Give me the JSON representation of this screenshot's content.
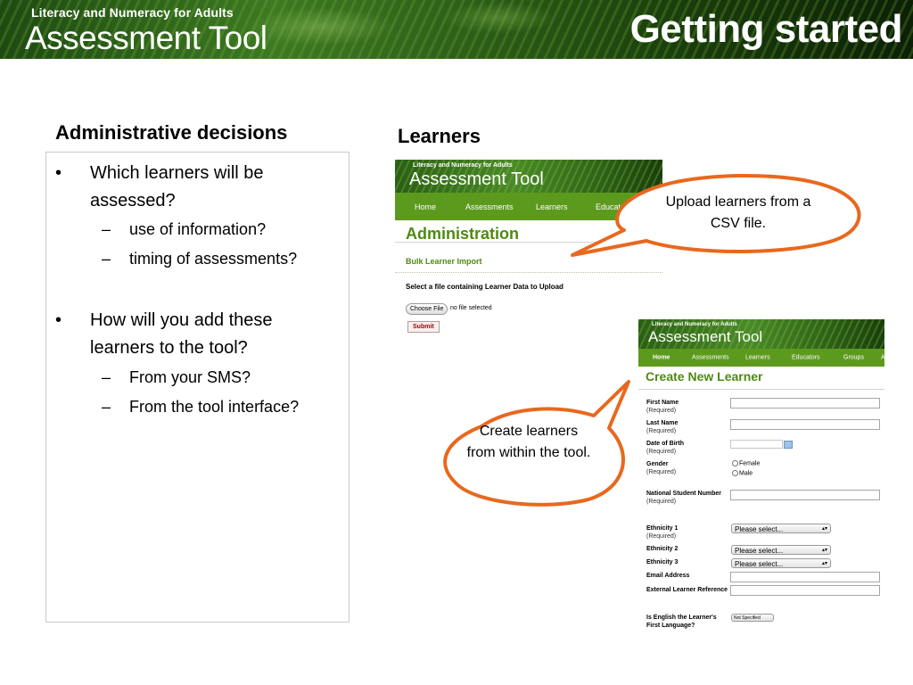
{
  "banner": {
    "logo_top": "Literacy and Numeracy for Adults",
    "logo_main": "Assessment Tool",
    "title": "Getting started"
  },
  "left": {
    "heading": "Administrative decisions",
    "items": [
      {
        "bullet": "•",
        "text": "Which learners will be assessed?",
        "subs": [
          {
            "dash": "–",
            "text": "use of information?"
          },
          {
            "dash": "–",
            "text": "timing of assessments?"
          }
        ]
      },
      {
        "bullet": "•",
        "text": "How will you add these learners to the tool?",
        "subs": [
          {
            "dash": "–",
            "text": "From your SMS?"
          },
          {
            "dash": "–",
            "text": "From the tool interface?"
          }
        ]
      }
    ]
  },
  "right": {
    "heading": "Learners"
  },
  "shot1": {
    "logo_top": "Literacy and Numeracy for Adults",
    "logo_main": "Assessment Tool",
    "nav": [
      "Home",
      "Assessments",
      "Learners",
      "Educators"
    ],
    "title": "Administration",
    "section": "Bulk Learner Import",
    "select_label": "Select a file containing Learner Data to Upload",
    "choose_button": "Choose File",
    "no_file": "no file selected",
    "submit_button": "Submit"
  },
  "shot2": {
    "logo_top": "Literacy and Numeracy for Adults",
    "logo_main": "Assessment Tool",
    "nav": [
      "Home",
      "Assessments",
      "Learners",
      "Educators",
      "Groups",
      "A"
    ],
    "title": "Create New Learner",
    "fields": {
      "first_name": "First Name",
      "last_name": "Last Name",
      "dob": "Date of Birth",
      "gender": "Gender",
      "nsn": "National Student Number",
      "ethnicity1": "Ethnicity 1",
      "ethnicity2": "Ethnicity 2",
      "ethnicity3": "Ethnicity 3",
      "email": "Email Address",
      "external_ref": "External Learner Reference",
      "english_first": "Is English the Learner's First Language?"
    },
    "required": "(Required)",
    "gender_options": [
      "Female",
      "Male"
    ],
    "select_placeholder": "Please select...",
    "not_specified": "Not Specified"
  },
  "callouts": {
    "upload": "Upload learners from a CSV file.",
    "create": "Create learners from within the tool."
  },
  "colors": {
    "callout_border": "#e8681e",
    "accent_green": "#4e8a10",
    "nav_green": "#5c9a1e"
  }
}
